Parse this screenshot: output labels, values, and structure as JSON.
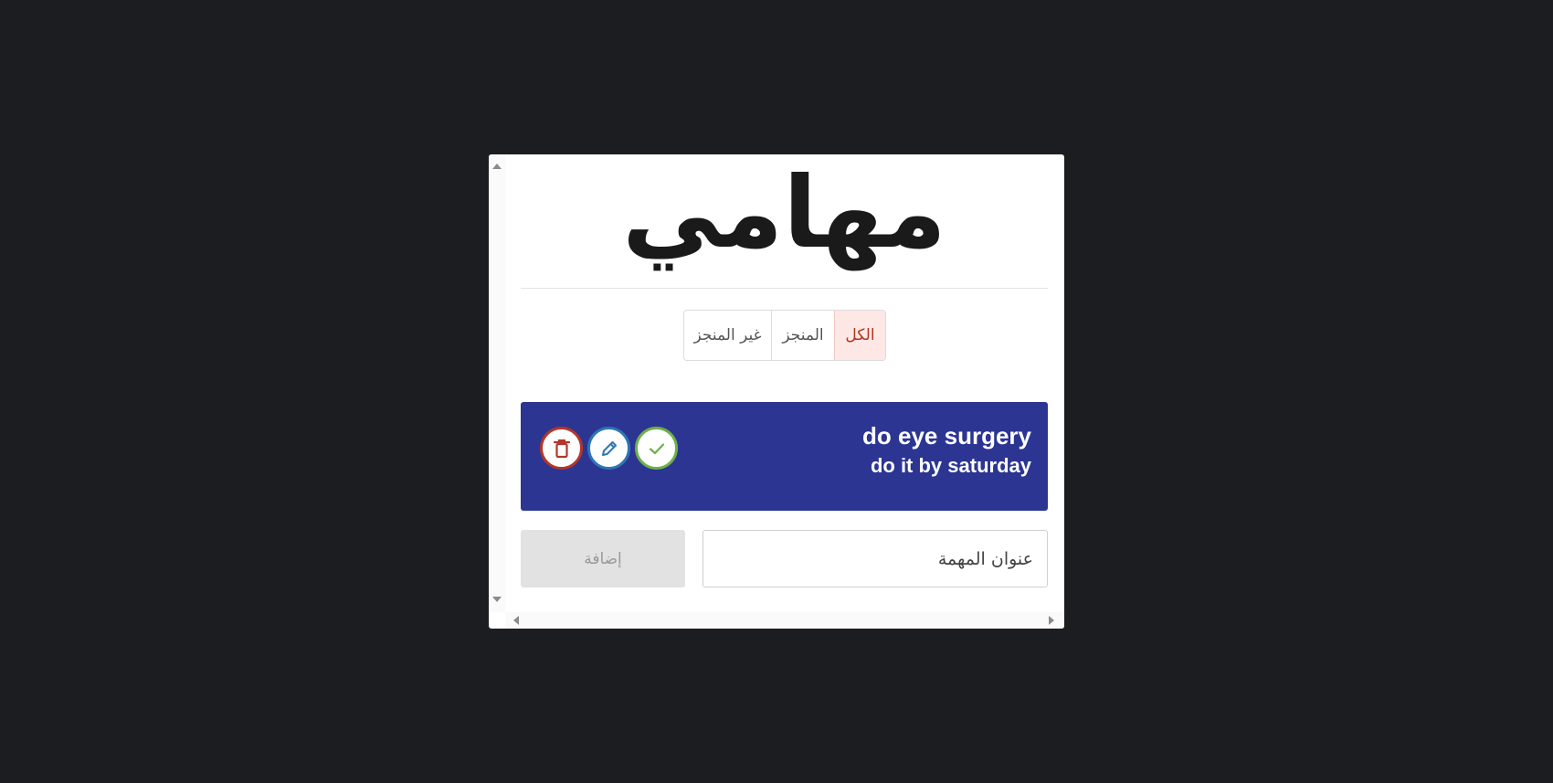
{
  "app": {
    "title": "مهامي"
  },
  "filters": {
    "all_label": "الكل",
    "done_label": "المنجز",
    "undone_label": "غير المنجز",
    "active": "all"
  },
  "tasks": [
    {
      "title": "do eye surgery",
      "description": "do it by saturday",
      "actions": {
        "delete_icon": "trash-icon",
        "edit_icon": "pencil-icon",
        "complete_icon": "check-icon"
      }
    }
  ],
  "new_task": {
    "placeholder": "عنوان المهمة",
    "value": "",
    "add_label": "إضافة"
  },
  "colors": {
    "page_background": "#1c1d21",
    "task_card": "#2c3592",
    "active_filter_bg": "#fde8e5",
    "active_filter_text": "#b5321b",
    "delete": "#b3362a",
    "edit": "#2d76b4",
    "complete": "#6fb04b",
    "add_button_disabled": "#e2e2e2"
  }
}
